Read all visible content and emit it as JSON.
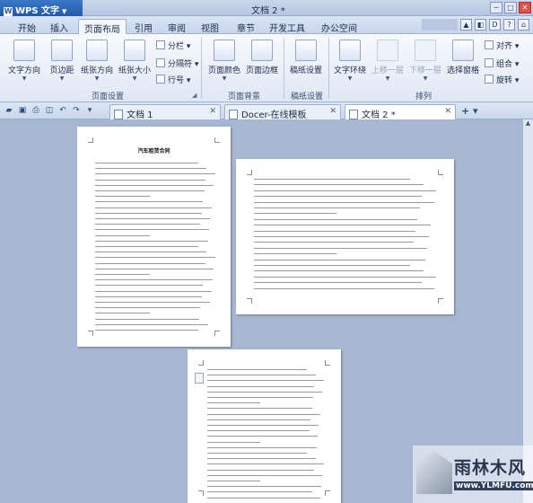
{
  "app": {
    "button_label": "WPS 文字",
    "window_title": "文档 2 *"
  },
  "menu": {
    "tabs": [
      "开始",
      "插入",
      "页面布局",
      "引用",
      "审阅",
      "视图",
      "章节",
      "开发工具",
      "办公空间"
    ],
    "active": "页面布局"
  },
  "ribbon": {
    "text_direction": "文字方向",
    "margins": "页边距",
    "orientation": "纸张方向",
    "paper_size": "纸张大小",
    "columns": "分栏",
    "breaks": "分隔符",
    "line_numbers": "行号",
    "page_setup_label": "页面设置",
    "page_color": "页面颜色",
    "page_border": "页面边框",
    "background_label": "页面背景",
    "manuscript": "稿纸设置",
    "manuscript_label": "稿纸设置",
    "wrap_text": "文字环绕",
    "bring_forward": "上移一层",
    "send_backward": "下移一层",
    "selection_pane": "选择窗格",
    "align": "对齐",
    "group": "组合",
    "rotate": "旋转",
    "arrange_label": "排列"
  },
  "tabs": [
    {
      "label": "文档 1"
    },
    {
      "label": "Docer-在线模板"
    },
    {
      "label": "文档 2 *"
    }
  ],
  "document": {
    "contract_title": "汽车租赁合同"
  },
  "watermark": {
    "title": "雨林木风",
    "url": "www.YLMFU.com"
  },
  "colors": {
    "title_bar": "#245aa5",
    "workspace": "#a7b7d2",
    "page": "#ffffff"
  }
}
